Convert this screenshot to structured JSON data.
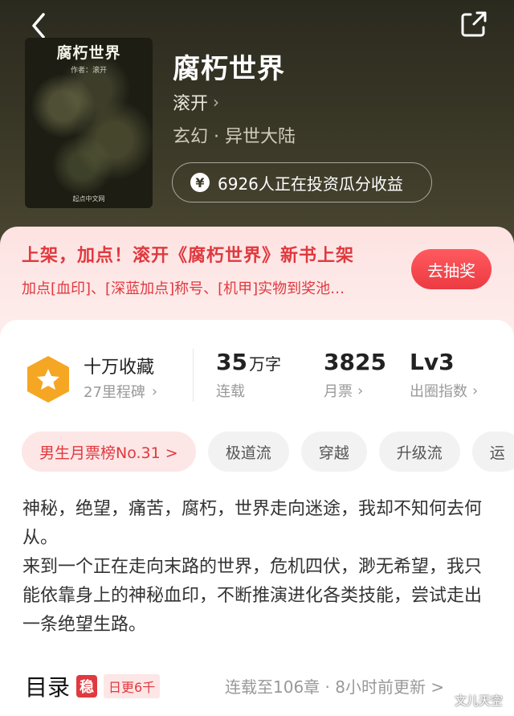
{
  "header": {
    "back_icon": "chevron-left-icon",
    "share_icon": "share-export-icon"
  },
  "book": {
    "title": "腐朽世界",
    "author": "滚开",
    "genre": "玄幻 · 异世大陆",
    "invest_text": "6926人正在投资瓜分收益",
    "yen_symbol": "¥",
    "cover": {
      "title": "腐朽世界",
      "author_line": "作者：滚开",
      "publisher": "起点中文网"
    }
  },
  "promo": {
    "title": "上架，加点！滚开《腐朽世界》新书上架",
    "subtitle": "加点[血印]、[深蓝加点]称号、[机甲]实物到奖池…",
    "button": "去抽奖"
  },
  "stats": {
    "favorites": {
      "main": "十万收藏",
      "sub": "27里程碑"
    },
    "words": {
      "value": "35",
      "unit": "万字",
      "label": "连载"
    },
    "monthly_votes": {
      "value": "3825",
      "label": "月票"
    },
    "popularity": {
      "value": "Lv3",
      "label": "出圈指数"
    }
  },
  "tags": [
    "男生月票榜No.31 >",
    "极道流",
    "穿越",
    "升级流",
    "运"
  ],
  "synopsis": {
    "p1": "神秘，绝望，痛苦，腐朽，世界走向迷途，我却不知何去何从。",
    "p2": "来到一个正在走向末路的世界，危机四伏，渺无希望，我只能依靠身上的神秘血印，不断推演进化各类技能，尝试走出一条绝望生路。"
  },
  "toc": {
    "title": "目录",
    "badge": "稳",
    "frequency": "日更6千",
    "status": "连载至106章 · 8小时前更新 >"
  },
  "watermark": "文儿天空",
  "colors": {
    "accent_red": "#e0393f",
    "hero_bg": "#3a3826",
    "badge_orange": "#f5a623"
  }
}
